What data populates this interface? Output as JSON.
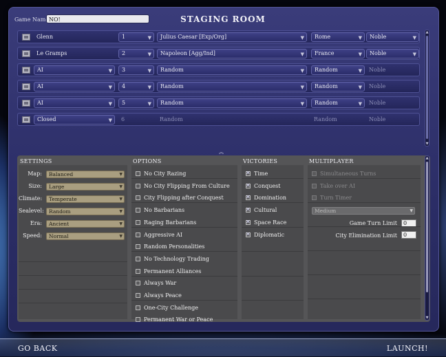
{
  "window": {
    "title": "STAGING ROOM"
  },
  "game_name": {
    "label": "Game Name",
    "value": "NO!"
  },
  "players": [
    {
      "name": "Glenn",
      "type_dropdown": false,
      "team": "1",
      "leader": "Julius Caesar [Exp/Org]",
      "civ": "Rome",
      "difficulty": "Noble",
      "active": true
    },
    {
      "name": "Le Gramps",
      "type_dropdown": false,
      "team": "2",
      "leader": "Napoleon [Agg/Ind]",
      "civ": "France",
      "difficulty": "Noble",
      "active": true
    },
    {
      "name": "AI",
      "type_dropdown": true,
      "team": "3",
      "leader": "Random",
      "civ": "Random",
      "difficulty": "Noble",
      "active": false
    },
    {
      "name": "AI",
      "type_dropdown": true,
      "team": "4",
      "leader": "Random",
      "civ": "Random",
      "difficulty": "Noble",
      "active": false
    },
    {
      "name": "AI",
      "type_dropdown": true,
      "team": "5",
      "leader": "Random",
      "civ": "Random",
      "difficulty": "Noble",
      "active": false
    },
    {
      "name": "Closed",
      "type_dropdown": true,
      "team": "6",
      "leader": "Random",
      "civ": "Random",
      "difficulty": "Noble",
      "active": false,
      "closed": true
    }
  ],
  "settings": {
    "header": "SETTINGS",
    "items": [
      {
        "label": "Map:",
        "value": "Balanced"
      },
      {
        "label": "Size:",
        "value": "Large"
      },
      {
        "label": "Climate:",
        "value": "Temperate"
      },
      {
        "label": "Sealevel:",
        "value": "Random"
      },
      {
        "label": "Era:",
        "value": "Ancient"
      },
      {
        "label": "Speed:",
        "value": "Normal"
      }
    ]
  },
  "options": {
    "header": "OPTIONS",
    "items": [
      {
        "label": "No City Razing",
        "checked": false
      },
      {
        "label": "No City Flipping From Culture",
        "checked": false
      },
      {
        "label": "City Flipping after Conquest",
        "checked": false
      },
      {
        "label": "No Barbarians",
        "checked": false
      },
      {
        "label": "Raging Barbarians",
        "checked": false
      },
      {
        "label": "Aggressive AI",
        "checked": false
      },
      {
        "label": "Random Personalities",
        "checked": false
      },
      {
        "label": "No Technology Trading",
        "checked": false
      },
      {
        "label": "Permanent Alliances",
        "checked": false
      },
      {
        "label": "Always War",
        "checked": false
      },
      {
        "label": "Always Peace",
        "checked": false
      },
      {
        "label": "One-City Challenge",
        "checked": false
      },
      {
        "label": "Permanent War or Peace",
        "checked": false
      }
    ]
  },
  "victories": {
    "header": "VICTORIES",
    "items": [
      {
        "label": "Time",
        "checked": true
      },
      {
        "label": "Conquest",
        "checked": true
      },
      {
        "label": "Domination",
        "checked": true
      },
      {
        "label": "Cultural",
        "checked": true
      },
      {
        "label": "Space Race",
        "checked": true
      },
      {
        "label": "Diplomatic",
        "checked": true
      }
    ]
  },
  "multiplayer": {
    "header": "MULTIPLAYER",
    "items": [
      {
        "label": "Simultaneous Turns",
        "checked": false
      },
      {
        "label": "Take over AI",
        "checked": false
      },
      {
        "label": "Turn Timer",
        "checked": false
      }
    ],
    "timer_speed": "Medium",
    "game_turn_limit": {
      "label": "Game Turn Limit",
      "value": "0"
    },
    "city_elimination_limit": {
      "label": "City Elimination Limit",
      "value": "0"
    }
  },
  "footer": {
    "back_label": "GO BACK",
    "launch_label": "LAUNCH!"
  },
  "colors": {
    "panel": "#2b2d66",
    "settings_bg": "#555557",
    "combo_tan": "#a99e80"
  }
}
